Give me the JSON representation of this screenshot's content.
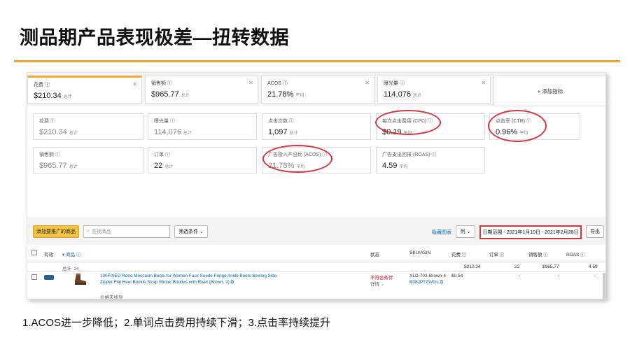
{
  "slide": {
    "title": "测品期产品表现极差—扭转数据",
    "caption": "1.ACOS进一步降低；2.单词点击费用持续下滑；3.点击率持续提升",
    "accent_color": "#f2a733",
    "highlight_color": "#d9343f"
  },
  "top_cards": [
    {
      "label": "花费 ⓘ",
      "value": "$210.34",
      "suffix": "总计"
    },
    {
      "label": "销售额 ⓘ",
      "value": "$965.77",
      "suffix": "总计"
    },
    {
      "label": "ACOS ⓘ",
      "value": "21.78%",
      "suffix": "平均"
    },
    {
      "label": "曝光量 ⓘ",
      "value": "114,076",
      "suffix": "总计"
    }
  ],
  "add_metric": "+ 添加指标",
  "metrics": [
    {
      "label": "花费 ⓘ",
      "value": "$210.34",
      "suffix": "总计"
    },
    {
      "label": "曝光量 ⓘ",
      "value": "114,076",
      "suffix": "总计"
    },
    {
      "label": "点击次数 ⓘ",
      "value": "1,097",
      "suffix": "总计"
    },
    {
      "label": "每次点击费用 (CPC) ⓘ",
      "value": "$0.19",
      "suffix": "平均"
    },
    {
      "label": "点击率 (CTR) ⓘ",
      "value": "0.96%",
      "suffix": "平均"
    },
    {
      "label": "销售额 ⓘ",
      "value": "$965.77",
      "suffix": "总计"
    },
    {
      "label": "订单 ⓘ",
      "value": "22",
      "suffix": "总计"
    },
    {
      "label": "广告投入产出比 (ACOS) ⓘ",
      "value": "21.78%",
      "suffix": "平均"
    },
    {
      "label": "广告支出回报 (ROAS) ⓘ",
      "value": "4.59",
      "suffix": "平均"
    }
  ],
  "toolbar": {
    "add_product": "添加要推广的商品",
    "search_placeholder": "查找商品",
    "filter": "筛选条件 ⌄",
    "hide_chart": "隐藏图表",
    "columns": "列 ⌄",
    "date_range": "日期范围 - 2021年1月10日 - 2021年2月28日",
    "export": "导出"
  },
  "table": {
    "headers": [
      "有效",
      "▾ 商品 ⓘ",
      "状态",
      "SKU/ASIN",
      "花费 ⓘ",
      "订单 ⓘ",
      "销售额 ⓘ",
      "ROAS ⓘ"
    ],
    "total_label": "总计: 24",
    "totals": {
      "spend": "$210.34",
      "orders": "22",
      "sales": "$965.77",
      "roas": "4.59"
    },
    "row": {
      "product_line1": "100FIXEO Retro Moccasin Boots for Women Faux Suede Fringe Ankle Boots Sewing Side",
      "product_line2": "Zipper Flat Heel Buckle Strap Winter Booties with Rivet (Brown, 9) ⧉",
      "product_note": "价格未找到",
      "status": "不符合条件",
      "status_detail": "详情 ⌄",
      "sku": "XLD-703-Brown-4",
      "asin": "B08JPTZWGL ⧉",
      "spend": "$0.54",
      "orders": "-",
      "sales": "-",
      "roas": "-"
    }
  }
}
